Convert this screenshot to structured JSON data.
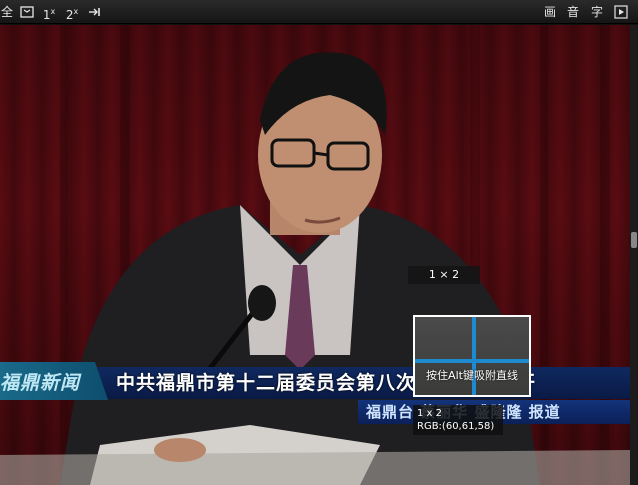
{
  "toolbar": {
    "left": {
      "full_label": "全",
      "scale1_label": "1",
      "scale1_sup": "x",
      "scale2_label": "2",
      "scale2_sup": "x"
    },
    "right": {
      "picture_label": "画",
      "audio_label": "音",
      "subtitle_label": "字"
    }
  },
  "video": {
    "lower_third": {
      "logo": "福鼎新闻",
      "headline": "中共福鼎市第十二届委员会第八次全体会议召开",
      "credit": "福鼎台  蔡丽华  盛隆隆  报道"
    }
  },
  "overlay": {
    "dimension_label": "1 × 2",
    "magnifier_hint": "按住Alt键吸附直线",
    "info_size": "1 x 2",
    "info_rgb": "RGB:(60,61,58)"
  },
  "colors": {
    "crosshair": "#1e8ad0",
    "headline_bg": "#0f2960",
    "curtain": "#5a0c12"
  }
}
